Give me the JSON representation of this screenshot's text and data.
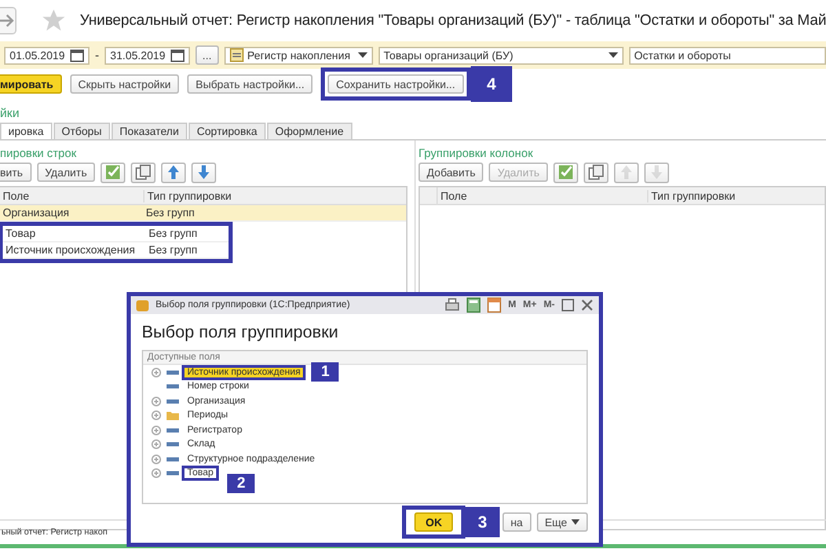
{
  "window": {
    "title": "Универсальный отчет: Регистр накопления \"Товары организаций (БУ)\" - таблица \"Остатки и обороты\" за Май"
  },
  "filters": {
    "date_from": "01.05.2019",
    "separator": "-",
    "date_to": "31.05.2019",
    "more": "...",
    "register_type": "Регистр накопления",
    "register": "Товары организаций (БУ)",
    "table": "Остатки и обороты"
  },
  "actions": [
    {
      "label": "мировать",
      "kind": "primary",
      "highlighted": false
    },
    {
      "label": "Скрыть настройки",
      "kind": "normal",
      "highlighted": false
    },
    {
      "label": "Выбрать настройки...",
      "kind": "normal",
      "highlighted": false
    },
    {
      "label": "Сохранить настройки...",
      "kind": "normal",
      "highlighted": true,
      "callout": "4"
    }
  ],
  "settings_link": "йки",
  "tabs": [
    {
      "label": "ировка",
      "selected": true
    },
    {
      "label": "Отборы",
      "selected": false
    },
    {
      "label": "Показатели",
      "selected": false
    },
    {
      "label": "Сортировка",
      "selected": false
    },
    {
      "label": "Оформление",
      "selected": false
    }
  ],
  "row_groups": {
    "title": "пировки строк",
    "buttons": [
      {
        "label": "вить",
        "disabled": false
      },
      {
        "label": "Удалить",
        "disabled": false
      }
    ],
    "icon_buttons": [
      {
        "kind": "check",
        "disabled": false
      },
      {
        "kind": "copy",
        "disabled": false
      },
      {
        "kind": "up",
        "disabled": false
      },
      {
        "kind": "down",
        "disabled": false
      }
    ],
    "columns": [
      "Поле",
      "Тип группировки"
    ],
    "rows": [
      {
        "field": "Организация",
        "type": "Без групп",
        "selected": true,
        "highlighted": false
      },
      {
        "field": "Товар",
        "type": "Без групп",
        "selected": false,
        "highlighted": true
      },
      {
        "field": "Источник происхождения",
        "type": "Без групп",
        "selected": false,
        "highlighted": true
      }
    ]
  },
  "column_groups": {
    "title": "Группировки колонок",
    "buttons": [
      {
        "label": "Добавить",
        "disabled": false
      },
      {
        "label": "Удалить",
        "disabled": true
      }
    ],
    "icon_buttons": [
      {
        "kind": "check",
        "disabled": false
      },
      {
        "kind": "copy",
        "disabled": false
      },
      {
        "kind": "up",
        "disabled": true
      },
      {
        "kind": "down",
        "disabled": true
      }
    ],
    "columns": [
      "Поле",
      "Тип группировки"
    ]
  },
  "dialog": {
    "title": "Выбор поля группировки  (1С:Предприятие)",
    "tools": [
      "M",
      "M+",
      "M-"
    ],
    "heading": "Выбор поля группировки",
    "tree_header": "Доступные поля",
    "items": [
      {
        "label": "Источник происхождения",
        "kind": "field",
        "expandable": true,
        "selected": true,
        "highlighted": true,
        "callout": "1"
      },
      {
        "label": "Номер строки",
        "kind": "field",
        "expandable": false,
        "selected": false,
        "highlighted": false
      },
      {
        "label": "Организация",
        "kind": "field",
        "expandable": true,
        "selected": false,
        "highlighted": false
      },
      {
        "label": "Периоды",
        "kind": "folder",
        "expandable": true,
        "selected": false,
        "highlighted": false
      },
      {
        "label": "Регистратор",
        "kind": "field",
        "expandable": true,
        "selected": false,
        "highlighted": false
      },
      {
        "label": "Склад",
        "kind": "field",
        "expandable": true,
        "selected": false,
        "highlighted": false
      },
      {
        "label": "Структурное подразделение",
        "kind": "field",
        "expandable": true,
        "selected": false,
        "highlighted": false
      },
      {
        "label": "Товар",
        "kind": "field",
        "expandable": true,
        "selected": false,
        "highlighted": true,
        "callout": "2"
      }
    ],
    "ok": "OK",
    "ok_callout": "3",
    "cancel_fragment": "на",
    "more": "Еще"
  },
  "taskbar": {
    "text": "ьный отчет: Регистр накоп"
  }
}
